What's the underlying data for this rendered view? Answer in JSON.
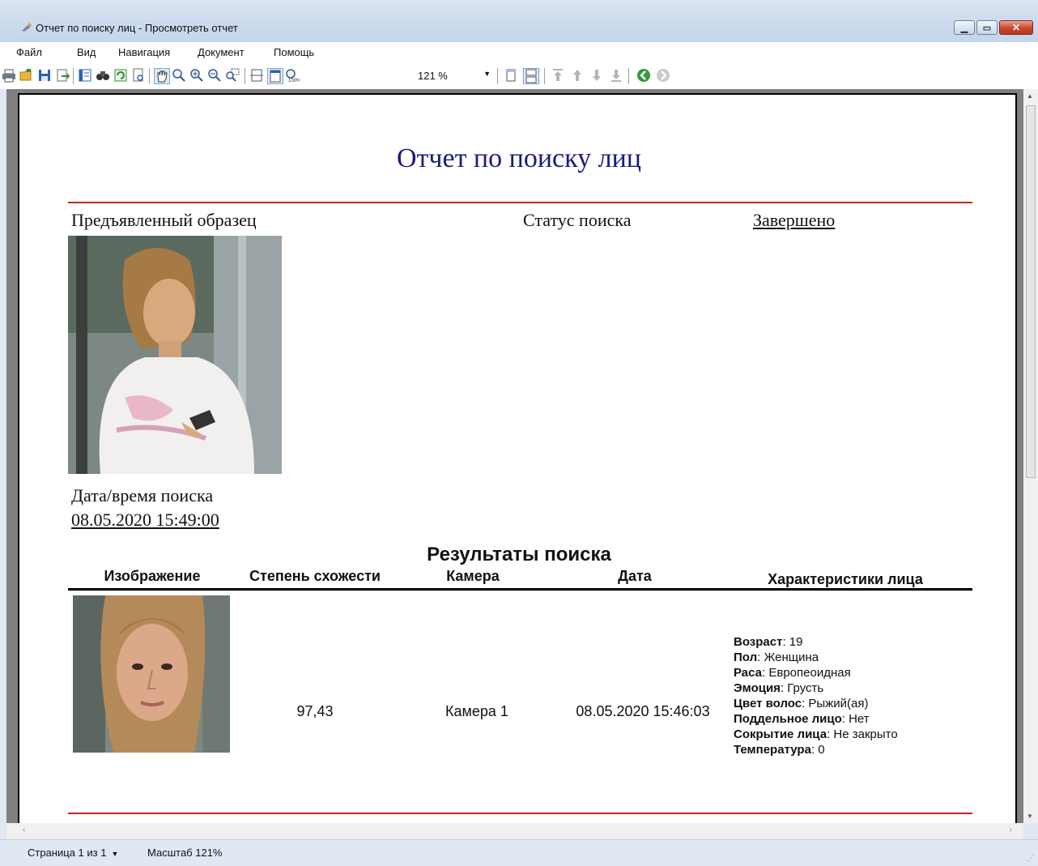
{
  "window": {
    "title": "Отчет по поиску лиц - Просмотреть отчет"
  },
  "menu": [
    "Файл",
    "Вид",
    "Навигация",
    "Документ",
    "Помощь"
  ],
  "toolbar": {
    "zoom_value": "121 %"
  },
  "report": {
    "title": "Отчет по поиску лиц",
    "sample_label": "Предъявленный образец",
    "status_label": "Статус поиска",
    "status_value": "Завершено",
    "datetime_label": "Дата/время поиска",
    "datetime_value": "08.05.2020 15:49:00",
    "results_heading": "Результаты поиска",
    "columns": {
      "image": "Изображение",
      "similarity": "Степень схожести",
      "camera": "Камера",
      "date": "Дата",
      "features": "Характеристики лица"
    },
    "result": {
      "similarity": "97,43",
      "camera": "Камера 1",
      "date": "08.05.2020 15:46:03",
      "attributes": [
        {
          "name": "Возраст",
          "value": ": 19"
        },
        {
          "name": "Пол",
          "value": ": Женщина"
        },
        {
          "name": "Раса",
          "value": ": Европеоидная"
        },
        {
          "name": "Эмоция",
          "value": ": Грусть"
        },
        {
          "name": "Цвет волос",
          "value": ": Рыжий(ая)"
        },
        {
          "name": "Поддельное лицо",
          "value": ": Нет"
        },
        {
          "name": "Сокрытие лица",
          "value": ": Не закрыто"
        },
        {
          "name": "Температура",
          "value": ": 0"
        }
      ]
    }
  },
  "statusbar": {
    "page": "Страница 1 из 1",
    "zoom": "Масштаб 121%"
  },
  "colors": {
    "title_blue": "#1a1a7e",
    "red_rule": "#c2281e"
  }
}
